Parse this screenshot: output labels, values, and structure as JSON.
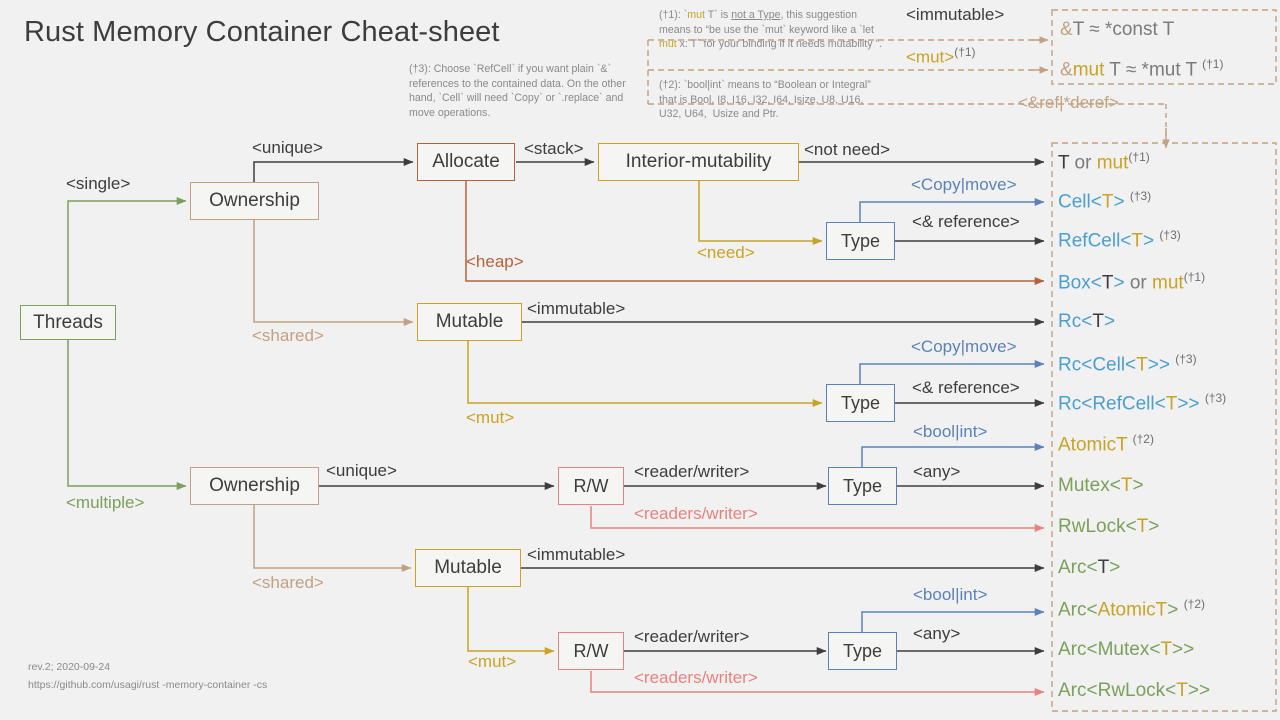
{
  "page": {
    "title": "Rust Memory Container Cheat-sheet",
    "bg": "#f1f1f1"
  },
  "footer": {
    "revision": "rev.2; 2020-09-24",
    "url": "https://github.com/usagi/rust -memory-container -cs"
  },
  "notes": [
    {
      "id": "note1",
      "marker": "(†1):",
      "text_html": "(†1): `<span class=\"kw\">mut</span> T` is <span class=\"ul\">not a Type</span>, this suggestion means to “be use the `mut` keyword like a `let <span class=\"kw\">mut</span> x: T` for your binding if it needs mutability ”.",
      "plain": "(†1): `mut T` is not a Type, this suggestion means to “be use the `mut` keyword like a `let mut x: T` for your binding if it needs mutability ”."
    },
    {
      "id": "note2",
      "marker": "(†2):",
      "text_html": "(†2): `bool|int` means to “Boolean or Integral” that is Bool, I8, I16, I32, I64, Isize, U8, U16, U32, U64,&nbsp; Usize and Ptr.",
      "plain": "(†2): `bool|int` means to “Boolean or Integral” that is Bool, I8, I16, I32, I64, Isize, U8, U16, U32, U64, Usize and Ptr."
    },
    {
      "id": "note3",
      "marker": "(†3):",
      "text_html": "(†3): Choose `RefCell` if you want plain `&` references to the contained data. On the other hand, `Cell` will need `Copy` or `.replace` and move operations.",
      "plain": "(†3): Choose `RefCell` if you want plain `&` references to the contained data. On the other hand, `Cell` will need `Copy` or `.replace` and move operations."
    }
  ],
  "nodes": {
    "threads": "Threads",
    "ownership_single": "Ownership",
    "ownership_multiple": "Ownership",
    "allocate": "Allocate",
    "interior_mutability": "Interior-mutability",
    "mutable_single": "Mutable",
    "mutable_multiple": "Mutable",
    "type_a": "Type",
    "type_b": "Type",
    "type_c": "Type",
    "type_d": "Type",
    "rw_a": "R/W",
    "rw_b": "R/W"
  },
  "edge_labels": {
    "single": "<single>",
    "multiple": "<multiple>",
    "unique_top": "<unique>",
    "unique_bottom": "<unique>",
    "shared_top": "<shared>",
    "shared_bottom": "<shared>",
    "stack": "<stack>",
    "heap": "<heap>",
    "not_need": "<not need>",
    "need": "<need>",
    "copy_move_a": "<Copy|move>",
    "amp_reference_a": "<& reference>",
    "copy_move_b": "<Copy|move>",
    "amp_reference_b": "<& reference>",
    "immutable_a": "<immutable>",
    "immutable_b": "<immutable>",
    "mut_a": "<mut>",
    "mut_b": "<mut>",
    "reader_writer_a": "<reader/writer>",
    "readers_writer_a": "<readers/writer>",
    "reader_writer_b": "<reader/writer>",
    "readers_writer_b": "<readers/writer>",
    "bool_int_a": "<bool|int>",
    "bool_int_b": "<bool|int>",
    "any_a": "<any>",
    "any_b": "<any>",
    "immutable_ref": "<immutable>",
    "mut_ref": "<mut>",
    "mut_ref_sup": "(†1)",
    "deref": "<&ref|*deref>"
  },
  "ref_box": {
    "line1_html": "<span class=\"tan\">&amp;</span>T ≈ *const T",
    "line1_plain": "&T ≈ *const T",
    "line2_html": "<span class=\"tan\">&amp;</span><span class=\"y\">mut</span> T ≈ *mut T <span class=\"sup\">(†1)</span>",
    "line2_plain": "&mut T ≈ *mut T (†1)"
  },
  "outputs": [
    {
      "plain": "T or mut(†1)",
      "html": "<span class=\"d\">T</span> <span class=\"gy\">or</span> <span class=\"y\">mut</span><span class=\"sup\">(†1)</span>"
    },
    {
      "plain": "Cell<T> (†3)",
      "html": "<span class=\"b\">Cell&lt;</span><span class=\"y\">T</span><span class=\"b\">&gt;</span> <span class=\"sup\">(†3)</span>"
    },
    {
      "plain": "RefCell<T> (†3)",
      "html": "<span class=\"b\">RefCell&lt;</span><span class=\"y\">T</span><span class=\"b\">&gt;</span> <span class=\"sup\">(†3)</span>"
    },
    {
      "plain": "Box<T> or mut(†1)",
      "html": "<span class=\"b\">Box&lt;</span><span class=\"d\">T</span><span class=\"b\">&gt;</span> <span class=\"gy\">or</span> <span class=\"y\">mut</span><span class=\"sup\">(†1)</span>"
    },
    {
      "plain": "Rc<T>",
      "html": "<span class=\"b\">Rc&lt;</span><span class=\"d\">T</span><span class=\"b\">&gt;</span>"
    },
    {
      "plain": "Rc<Cell<T>> (†3)",
      "html": "<span class=\"b\">Rc&lt;Cell&lt;</span><span class=\"y\">T</span><span class=\"b\">&gt;&gt;</span> <span class=\"sup\">(†3)</span>"
    },
    {
      "plain": "Rc<RefCell<T>> (†3)",
      "html": "<span class=\"b\">Rc&lt;RefCell&lt;</span><span class=\"y\">T</span><span class=\"b\">&gt;&gt;</span> <span class=\"sup\">(†3)</span>"
    },
    {
      "plain": "AtomicT (†2)",
      "html": "<span class=\"y\">AtomicT</span> <span class=\"sup\">(†2)</span>"
    },
    {
      "plain": "Mutex<T>",
      "html": "<span class=\"g\">Mutex&lt;</span><span class=\"y\">T</span><span class=\"g\">&gt;</span>"
    },
    {
      "plain": "RwLock<T>",
      "html": "<span class=\"g\">RwLock&lt;</span><span class=\"y\">T</span><span class=\"g\">&gt;</span>"
    },
    {
      "plain": "Arc<T>",
      "html": "<span class=\"g\">Arc&lt;</span><span class=\"d\">T</span><span class=\"g\">&gt;</span>"
    },
    {
      "plain": "Arc<AtomicT> (†2)",
      "html": "<span class=\"g\">Arc&lt;</span><span class=\"y\">AtomicT</span><span class=\"g\">&gt;</span> <span class=\"sup\">(†2)</span>"
    },
    {
      "plain": "Arc<Mutex<T>>",
      "html": "<span class=\"g\">Arc&lt;Mutex&lt;</span><span class=\"y\">T</span><span class=\"g\">&gt;&gt;</span>"
    },
    {
      "plain": "Arc<RwLock<T>>",
      "html": "<span class=\"g\">Arc&lt;RwLock&lt;</span><span class=\"y\">T</span><span class=\"g\">&gt;&gt;</span>"
    }
  ],
  "colors": {
    "background": "#f1f1f1",
    "text": "#3d3d3d",
    "muted": "#8a8a8a",
    "green": "#7aa05a",
    "tan": "#c2a182",
    "brown": "#b5623a",
    "gold": "#c8a326",
    "blue": "#5b82b8",
    "blue_text": "#4a9fd0",
    "red": "#e8827e",
    "dark_line": "#3d3d3d"
  }
}
